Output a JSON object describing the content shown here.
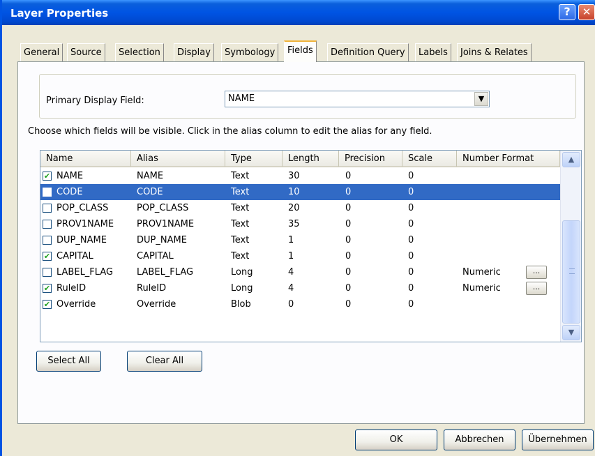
{
  "window": {
    "title": "Layer Properties",
    "help_glyph": "?",
    "close_glyph": "✕"
  },
  "tabs": [
    {
      "label": "General"
    },
    {
      "label": "Source"
    },
    {
      "label": "Selection"
    },
    {
      "label": "Display"
    },
    {
      "label": "Symbology"
    },
    {
      "label": "Fields",
      "active": true
    },
    {
      "label": "Definition Query"
    },
    {
      "label": "Labels"
    },
    {
      "label": "Joins & Relates"
    }
  ],
  "primary_display": {
    "label": "Primary Display Field:",
    "value": "NAME",
    "arrow": "▼"
  },
  "instructions": "Choose which fields will be visible. Click in the alias column to edit the alias for any field.",
  "grid": {
    "columns": [
      "Name",
      "Alias",
      "Type",
      "Length",
      "Precision",
      "Scale",
      "Number Format"
    ],
    "rows": [
      {
        "checked": true,
        "name": "NAME",
        "alias": "NAME",
        "type": "Text",
        "length": "30",
        "precision": "0",
        "scale": "0",
        "format": ""
      },
      {
        "checked": false,
        "name": "CODE",
        "alias": "CODE",
        "type": "Text",
        "length": "10",
        "precision": "0",
        "scale": "0",
        "format": "",
        "selected": true
      },
      {
        "checked": false,
        "name": "POP_CLASS",
        "alias": "POP_CLASS",
        "type": "Text",
        "length": "20",
        "precision": "0",
        "scale": "0",
        "format": ""
      },
      {
        "checked": false,
        "name": "PROV1NAME",
        "alias": "PROV1NAME",
        "type": "Text",
        "length": "35",
        "precision": "0",
        "scale": "0",
        "format": ""
      },
      {
        "checked": false,
        "name": "DUP_NAME",
        "alias": "DUP_NAME",
        "type": "Text",
        "length": "1",
        "precision": "0",
        "scale": "0",
        "format": ""
      },
      {
        "checked": true,
        "name": "CAPITAL",
        "alias": "CAPITAL",
        "type": "Text",
        "length": "1",
        "precision": "0",
        "scale": "0",
        "format": ""
      },
      {
        "checked": false,
        "name": "LABEL_FLAG",
        "alias": "LABEL_FLAG",
        "type": "Long",
        "length": "4",
        "precision": "0",
        "scale": "0",
        "format": "Numeric",
        "has_button": true
      },
      {
        "checked": true,
        "name": "RuleID",
        "alias": "RuleID",
        "type": "Long",
        "length": "4",
        "precision": "0",
        "scale": "0",
        "format": "Numeric",
        "has_button": true
      },
      {
        "checked": true,
        "name": "Override",
        "alias": "Override",
        "type": "Blob",
        "length": "0",
        "precision": "0",
        "scale": "0",
        "format": ""
      }
    ],
    "ellipsis": "...",
    "check_glyph": "✔",
    "scroll_up_glyph": "▲",
    "scroll_down_glyph": "▼"
  },
  "buttons": {
    "select_all": "Select All",
    "clear_all": "Clear All",
    "ok": "OK",
    "cancel": "Abbrechen",
    "apply": "Übernehmen"
  },
  "colors": {
    "titlebar": "#0054e3",
    "selection": "#316ac5",
    "dialog_bg": "#ece9d8",
    "active_tab_accent": "#f0b33a"
  }
}
